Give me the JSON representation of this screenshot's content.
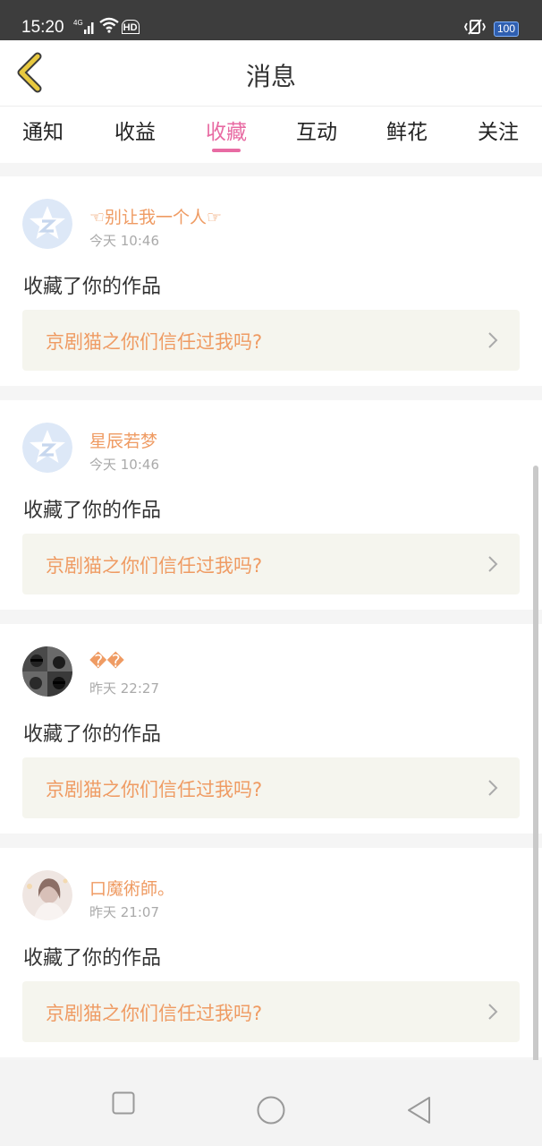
{
  "status_bar": {
    "time": "15:20",
    "network": "4G",
    "hd": "HD",
    "battery": "100"
  },
  "header": {
    "title": "消息"
  },
  "tabs": [
    {
      "label": "通知"
    },
    {
      "label": "收益"
    },
    {
      "label": "收藏",
      "active": true
    },
    {
      "label": "互动"
    },
    {
      "label": "鲜花"
    },
    {
      "label": "关注"
    }
  ],
  "messages": [
    {
      "username": "☜别让我一个人☞",
      "time": "今天 10:46",
      "action": "收藏了你的作品",
      "work_title": "京剧猫之你们信任过我吗?",
      "avatar": "qq-default-avatar"
    },
    {
      "username": "星辰若梦",
      "time": "今天 10:46",
      "action": "收藏了你的作品",
      "work_title": "京剧猫之你们信任过我吗?",
      "avatar": "qq-default-avatar"
    },
    {
      "username": "��",
      "time": "昨天 22:27",
      "action": "收藏了你的作品",
      "work_title": "京剧猫之你们信任过我吗?",
      "avatar": "photo-avatar-dark"
    },
    {
      "username": "口魔術師。",
      "time": "昨天 21:07",
      "action": "收藏了你的作品",
      "work_title": "京剧猫之你们信任过我吗?",
      "avatar": "photo-avatar-light"
    }
  ],
  "colors": {
    "accent_pink": "#e86ba3",
    "name_orange": "#ef9b63",
    "status_bar_bg": "#3d3d3d",
    "link_bg": "#f5f5ee"
  }
}
